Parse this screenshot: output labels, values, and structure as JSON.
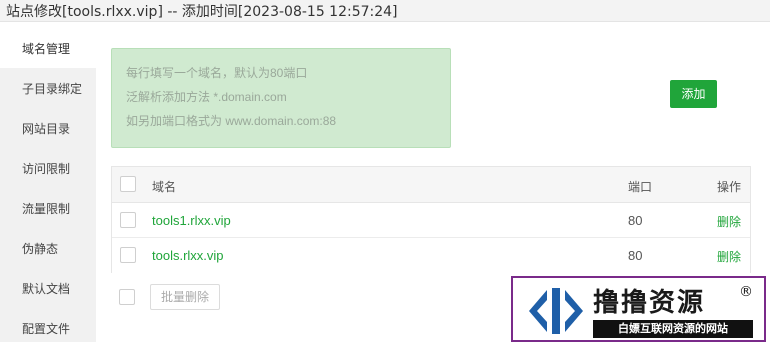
{
  "title": "站点修改[tools.rlxx.vip] -- 添加时间[2023-08-15 12:57:24]",
  "sidebar": {
    "items": [
      {
        "label": "域名管理",
        "active": true
      },
      {
        "label": "子目录绑定"
      },
      {
        "label": "网站目录"
      },
      {
        "label": "访问限制"
      },
      {
        "label": "流量限制"
      },
      {
        "label": "伪静态"
      },
      {
        "label": "默认文档"
      },
      {
        "label": "配置文件"
      }
    ]
  },
  "hint": {
    "lines": [
      "每行填写一个域名，默认为80端口",
      "泛解析添加方法 *.domain.com",
      "如另加端口格式为 www.domain.com:88"
    ]
  },
  "add_button": "添加",
  "table": {
    "headers": {
      "domain": "域名",
      "port": "端口",
      "action": "操作"
    },
    "rows": [
      {
        "domain": "tools1.rlxx.vip",
        "port": "80",
        "action": "删除"
      },
      {
        "domain": "tools.rlxx.vip",
        "port": "80",
        "action": "删除"
      }
    ]
  },
  "batch_delete": "批量删除",
  "watermark": {
    "title": "撸撸资源",
    "registered": "®",
    "subtitle": "白嫖互联网资源的网站"
  },
  "colors": {
    "accent": "#20a53a",
    "hint_bg": "#d0ead0"
  }
}
